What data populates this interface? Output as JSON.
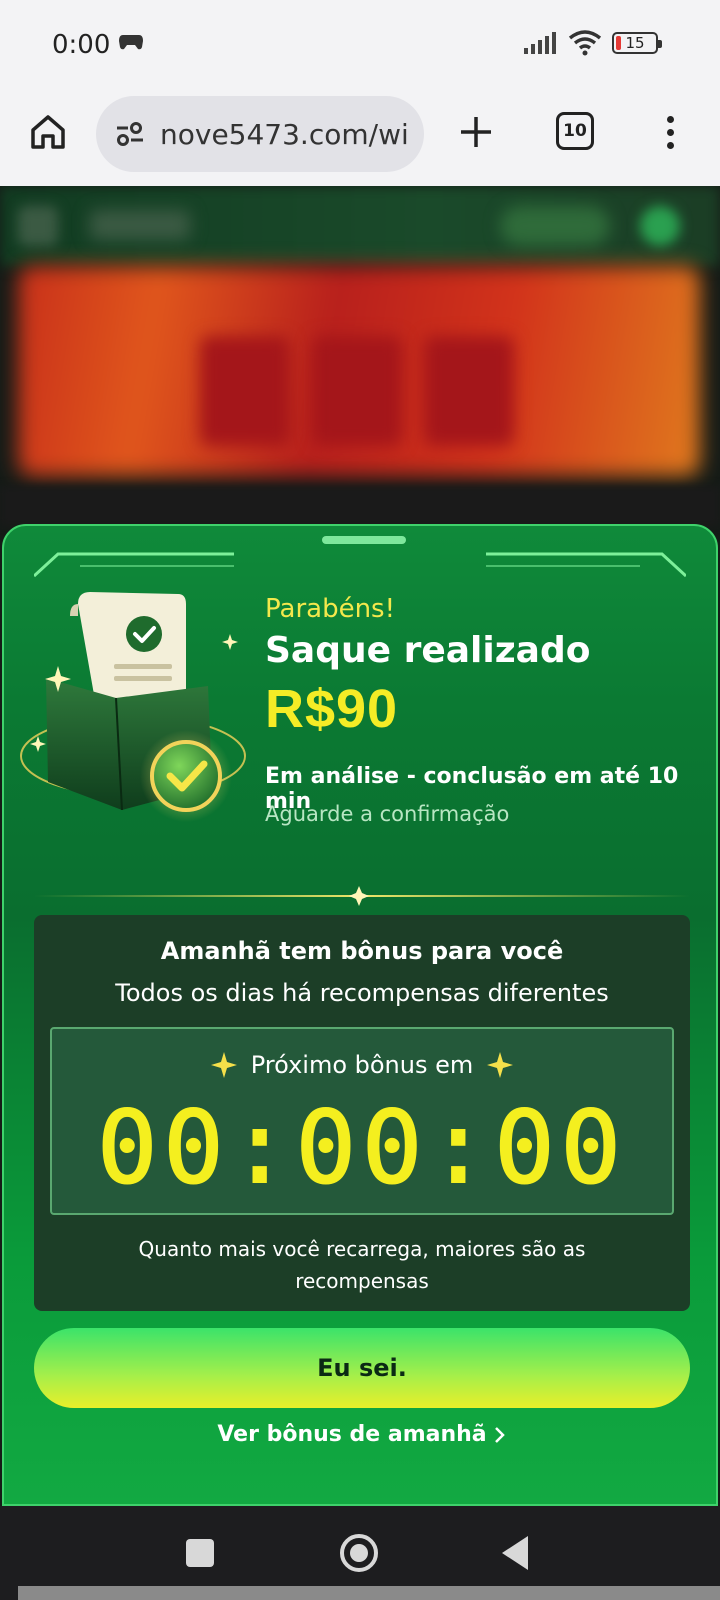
{
  "status_bar": {
    "time": "0:00",
    "battery_level": "15",
    "icons": [
      "gamepad-icon",
      "signal-icon",
      "wifi-icon",
      "battery-icon"
    ]
  },
  "browser": {
    "url": "nove5473.com/wi",
    "tab_count": "10",
    "icons": [
      "home-icon",
      "site-settings-icon",
      "new-tab-icon",
      "tabs-icon",
      "more-menu-icon"
    ]
  },
  "modal": {
    "congrats": "Parabéns!",
    "title": "Saque realizado",
    "amount": "R$90",
    "analysis": "Em análise - conclusão em até 10 min",
    "await": "Aguarde a confirmação",
    "bonus": {
      "title": "Amanhã tem bônus para você",
      "subtitle": "Todos os dias há recompensas diferentes",
      "next_label": "Próximo bônus em",
      "timer": "00:00:00",
      "note": "Quanto mais você recarrega, maiores são as recompensas"
    },
    "ok_button": "Eu sei.",
    "tomorrow_link": "Ver bônus de amanhã"
  },
  "colors": {
    "modal_green": "#0a7a33",
    "accent_yellow": "#f5ec26",
    "dark_panel": "#1c3e27"
  }
}
